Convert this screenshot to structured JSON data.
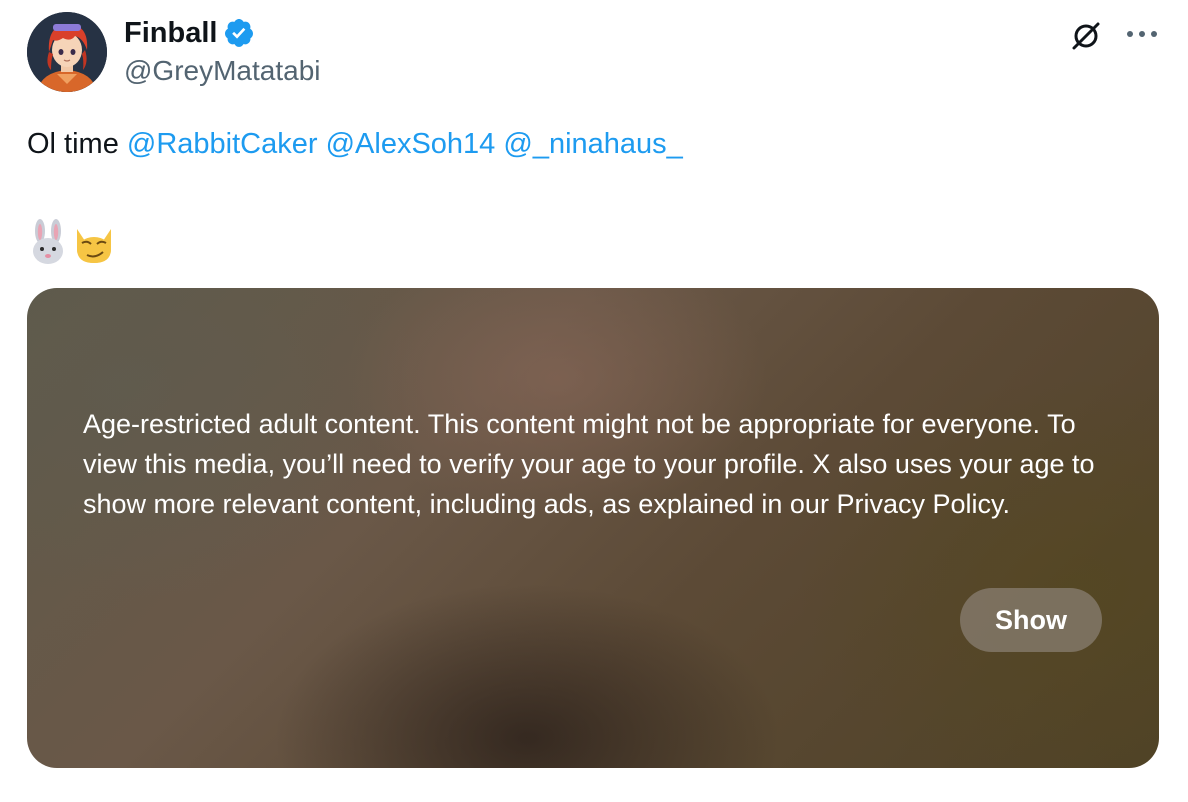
{
  "author": {
    "display_name": "Finball",
    "handle": "@GreyMatatabi",
    "verified": true,
    "verified_color": "#1d9bf0"
  },
  "header_actions": {
    "grok_icon": "grok-icon",
    "more_icon": "more-horizontal-icon"
  },
  "tweet": {
    "text_prefix": "Ol time ",
    "mentions": [
      "@RabbitCaker",
      "@AlexSoh14",
      "@_ninahaus_"
    ],
    "emojis": [
      "rabbit-face-emoji",
      "smirking-cat-emoji"
    ],
    "mention_color": "#1d9bf0"
  },
  "media": {
    "warning": "Age-restricted adult content. This content might not be appropriate for everyone. To view this media, you’ll need to verify your age to your profile. X also uses your age to show more relevant content, including ads, as explained in our Privacy Policy.",
    "show_label": "Show"
  }
}
